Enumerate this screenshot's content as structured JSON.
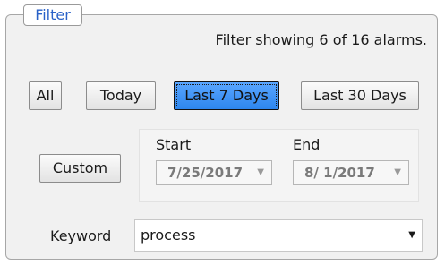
{
  "filter_group": {
    "legend": "Filter",
    "status_text": "Filter showing 6 of 16 alarms."
  },
  "buttons": {
    "all": "All",
    "today": "Today",
    "last_7_days": "Last 7 Days",
    "last_30_days": "Last 30 Days",
    "custom": "Custom"
  },
  "selected_range": "Last 7 Days",
  "date_range": {
    "start_label": "Start",
    "start_value": "7/25/2017",
    "end_label": "End",
    "end_value": "8/ 1/2017"
  },
  "keyword": {
    "label": "Keyword",
    "value": "process"
  },
  "colors": {
    "active_button": "#2d86ee",
    "legend_text": "#2a62c8"
  },
  "icons": {
    "dropdown": "chevron-down-icon"
  }
}
